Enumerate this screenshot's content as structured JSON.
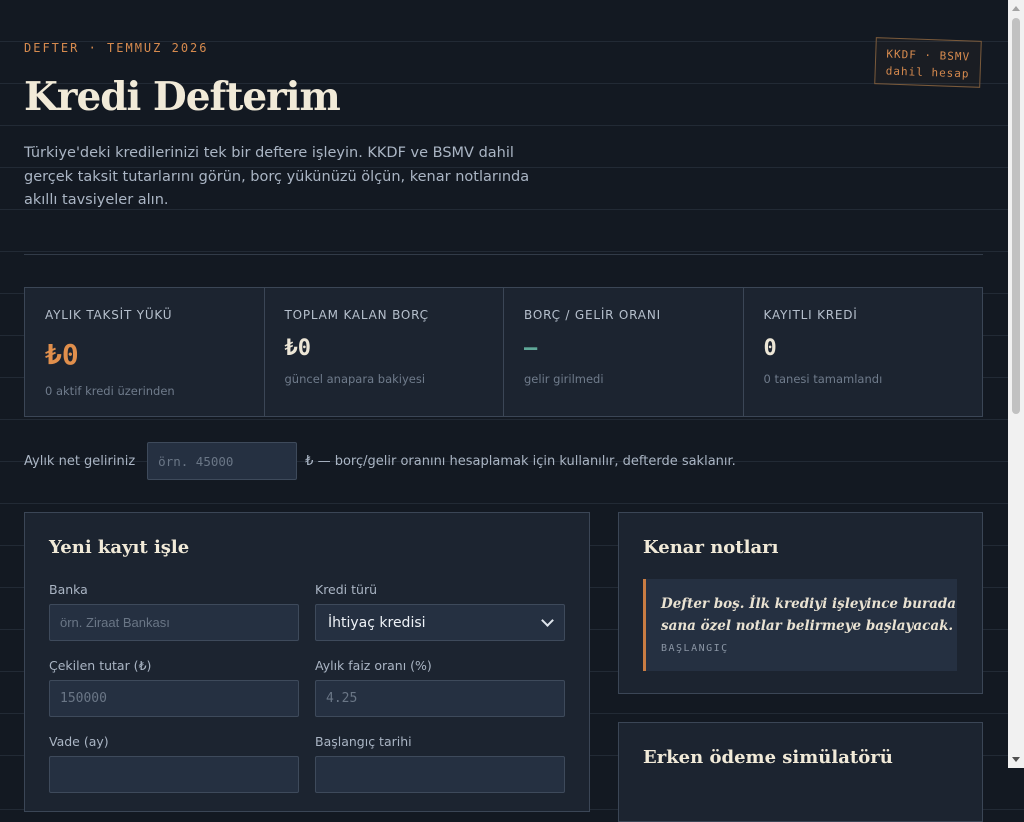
{
  "header": {
    "eyebrow": "DEFTER · TEMMUZ 2026",
    "title": "Kredi Defterim",
    "intro": "Türkiye'deki kredilerinizi tek bir deftere işleyin. KKDF ve BSMV dahil gerçek taksit tutarlarını görün, borç yükünüzü ölçün, kenar notlarında akıllı tavsiyeler alın.",
    "stamp_line1": "KKDF · BSMV",
    "stamp_line2": "dahil hesap"
  },
  "stats": [
    {
      "label": "AYLIK TAKSİT YÜKÜ",
      "value": "₺0",
      "sub": "0 aktif kredi üzerinden"
    },
    {
      "label": "TOPLAM KALAN BORÇ",
      "value": "₺0",
      "sub": "güncel anapara bakiyesi"
    },
    {
      "label": "BORÇ / GELİR ORANI",
      "value": "—",
      "sub": "gelir girilmedi"
    },
    {
      "label": "KAYITLI KREDİ",
      "value": "0",
      "sub": "0 tanesi tamamlandı"
    }
  ],
  "income": {
    "label": "Aylık net geliriniz",
    "placeholder": "örn. 45000",
    "value": "",
    "hint": "₺ — borç/gelir oranını hesaplamak için kullanılır, defterde saklanır."
  },
  "form": {
    "title": "Yeni kayıt işle",
    "bank_label": "Banka",
    "bank_placeholder": "örn. Ziraat Bankası",
    "type_label": "Kredi türü",
    "type_selected": "İhtiyaç kredisi",
    "amount_label": "Çekilen tutar (₺)",
    "amount_placeholder": "150000",
    "rate_label": "Aylık faiz oranı (%)",
    "rate_placeholder": "4.25",
    "term_label": "Vade (ay)",
    "start_label": "Başlangıç tarihi"
  },
  "side": {
    "title": "Kenar notları",
    "note_text": "Defter boş. İlk krediyi işleyince burada sana özel notlar belirmeye başlayacak.",
    "note_tag": "BAŞLANGIÇ"
  },
  "simulator": {
    "title": "Erken ödeme simülatörü"
  },
  "colors": {
    "background": "#131922",
    "panel": "#1c2430",
    "accent": "#d68a4e",
    "title": "#f1ead8"
  }
}
